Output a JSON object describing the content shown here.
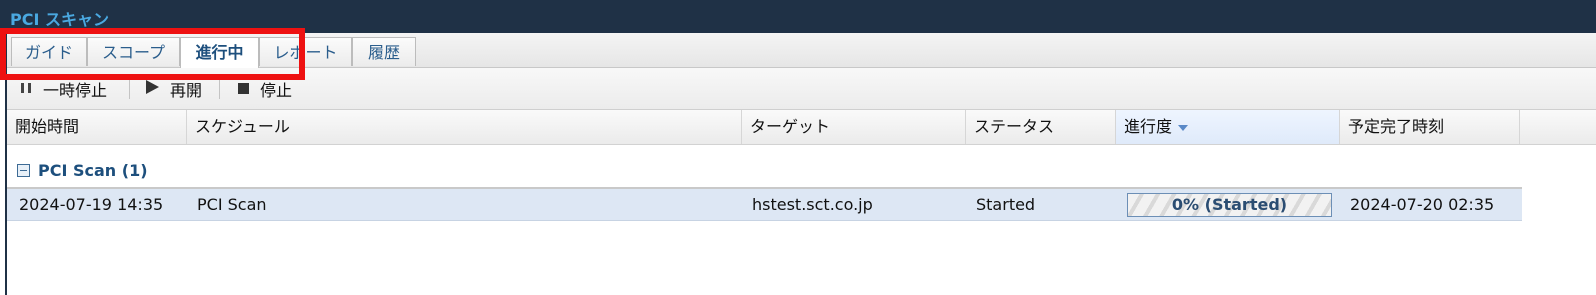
{
  "window": {
    "title": "PCI スキャン"
  },
  "tabs": [
    {
      "label": "ガイド"
    },
    {
      "label": "スコープ"
    },
    {
      "label": "進行中",
      "active": true
    },
    {
      "label": "レポート"
    },
    {
      "label": "履歴"
    }
  ],
  "toolbar": {
    "pause_label": "一時停止",
    "resume_label": "再開",
    "stop_label": "停止",
    "icons": {
      "pause": "pause-icon",
      "resume": "play-icon",
      "stop": "stop-icon"
    }
  },
  "table": {
    "columns": [
      "開始時間",
      "スケジュール",
      "ターゲット",
      "ステータス",
      "進行度",
      "予定完了時刻"
    ],
    "sort_column": "進行度",
    "group": {
      "label": "PCI Scan (1)"
    },
    "rows": [
      {
        "start_time": "2024-07-19 14:35",
        "schedule": "PCI Scan",
        "target": "hstest.sct.co.jp",
        "status": "Started",
        "progress_label": "0% (Started)",
        "progress_value": 0,
        "eta": "2024-07-20 02:35"
      }
    ]
  },
  "colors": {
    "titlebar": "#1f3146",
    "title_text": "#4aa8e0",
    "highlight": "#ee1111",
    "row_selected": "#dde7f4"
  }
}
